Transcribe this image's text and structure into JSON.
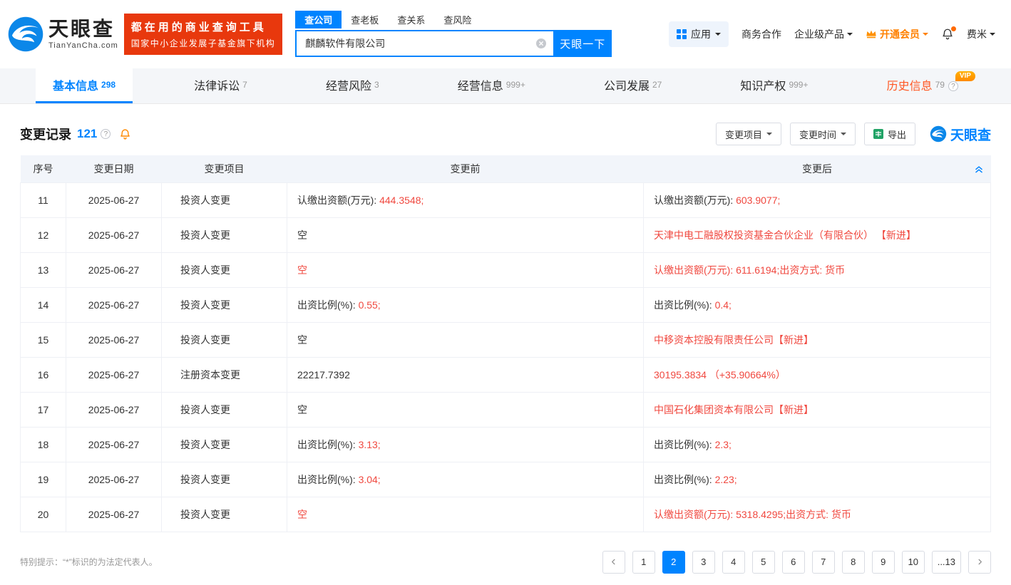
{
  "colors": {
    "primary": "#0084ff",
    "red": "#f0483f",
    "orange": "#ff8000",
    "vip_orange": "#ff9000",
    "slogan_red": "#e8380d",
    "excel_green": "#21a366",
    "history_tab": "#ff5722"
  },
  "brand": {
    "name": "天眼查",
    "domain": "TianYanCha.com",
    "slogan_line1": "都在用的商业查询工具",
    "slogan_line2": "国家中小企业发展子基金旗下机构"
  },
  "search": {
    "tabs": [
      {
        "label": "查公司",
        "active": true
      },
      {
        "label": "查老板",
        "active": false
      },
      {
        "label": "查关系",
        "active": false
      },
      {
        "label": "查风险",
        "active": false
      }
    ],
    "value": "麒麟软件有限公司",
    "button_label": "天眼一下"
  },
  "topnav": {
    "apps_label": "应用",
    "business_label": "商务合作",
    "enterprise_label": "企业级产品",
    "vip_label": "开通会员",
    "username": "费米"
  },
  "vip_badge": "VIP",
  "company_tabs": [
    {
      "label": "基本信息",
      "count": "298",
      "active": true
    },
    {
      "label": "法律诉讼",
      "count": "7"
    },
    {
      "label": "经营风险",
      "count": "3"
    },
    {
      "label": "经营信息",
      "count": "999+"
    },
    {
      "label": "公司发展",
      "count": "27"
    },
    {
      "label": "知识产权",
      "count": "999+"
    },
    {
      "label": "历史信息",
      "count": "79",
      "vip": true,
      "help": true
    }
  ],
  "section": {
    "title": "变更记录",
    "count": "121",
    "filter_project_label": "变更项目",
    "filter_time_label": "变更时间",
    "export_label": "导出",
    "watermark": "天眼查"
  },
  "table": {
    "headers": [
      "序号",
      "变更日期",
      "变更项目",
      "变更前",
      "变更后"
    ],
    "rows": [
      {
        "no": "11",
        "date": "2025-06-27",
        "item": "投资人变更",
        "before": [
          {
            "text": "认缴出资额(万元): ",
            "red": false
          },
          {
            "text": "444.3548;",
            "red": true
          }
        ],
        "after": [
          {
            "text": "认缴出资额(万元): ",
            "red": false
          },
          {
            "text": "603.9077;",
            "red": true
          }
        ]
      },
      {
        "no": "12",
        "date": "2025-06-27",
        "item": "投资人变更",
        "before": [
          {
            "text": "空",
            "red": false
          }
        ],
        "after": [
          {
            "text": "天津中电工融股权投资基金合伙企业（有限合伙） ",
            "red": true,
            "link": true
          },
          {
            "text": "【新进】",
            "red": true
          }
        ]
      },
      {
        "no": "13",
        "date": "2025-06-27",
        "item": "投资人变更",
        "before": [
          {
            "text": "空",
            "red": true
          }
        ],
        "after": [
          {
            "text": "认缴出资额(万元): 611.6194;出资方式: 货币",
            "red": true
          }
        ]
      },
      {
        "no": "14",
        "date": "2025-06-27",
        "item": "投资人变更",
        "before": [
          {
            "text": "出资比例(%): ",
            "red": false
          },
          {
            "text": "0.55;",
            "red": true
          }
        ],
        "after": [
          {
            "text": "出资比例(%): ",
            "red": false
          },
          {
            "text": "0.4;",
            "red": true
          }
        ]
      },
      {
        "no": "15",
        "date": "2025-06-27",
        "item": "投资人变更",
        "before": [
          {
            "text": "空",
            "red": false
          }
        ],
        "after": [
          {
            "text": "中移资本控股有限责任公司",
            "red": true,
            "link": true
          },
          {
            "text": "【新进】",
            "red": true
          }
        ]
      },
      {
        "no": "16",
        "date": "2025-06-27",
        "item": "注册资本变更",
        "before": [
          {
            "text": "22217.7392",
            "red": false
          }
        ],
        "after": [
          {
            "text": "30195.3834 （+35.90664%）",
            "red": true
          }
        ]
      },
      {
        "no": "17",
        "date": "2025-06-27",
        "item": "投资人变更",
        "before": [
          {
            "text": "空",
            "red": false
          }
        ],
        "after": [
          {
            "text": "中国石化集团资本有限公司",
            "red": true,
            "link": true
          },
          {
            "text": "【新进】",
            "red": true
          }
        ]
      },
      {
        "no": "18",
        "date": "2025-06-27",
        "item": "投资人变更",
        "before": [
          {
            "text": "出资比例(%): ",
            "red": false
          },
          {
            "text": "3.13;",
            "red": true
          }
        ],
        "after": [
          {
            "text": "出资比例(%): ",
            "red": false
          },
          {
            "text": "2.3;",
            "red": true
          }
        ]
      },
      {
        "no": "19",
        "date": "2025-06-27",
        "item": "投资人变更",
        "before": [
          {
            "text": "出资比例(%): ",
            "red": false
          },
          {
            "text": "3.04;",
            "red": true
          }
        ],
        "after": [
          {
            "text": "出资比例(%): ",
            "red": false
          },
          {
            "text": "2.23;",
            "red": true
          }
        ]
      },
      {
        "no": "20",
        "date": "2025-06-27",
        "item": "投资人变更",
        "before": [
          {
            "text": "空",
            "red": true
          }
        ],
        "after": [
          {
            "text": "认缴出资额(万元): 5318.4295;出资方式: 货币",
            "red": true
          }
        ]
      }
    ]
  },
  "footer_note": "特别提示：“*”标识的为法定代表人。",
  "pagination": {
    "pages": [
      "1",
      "2",
      "3",
      "4",
      "5",
      "6",
      "7",
      "8",
      "9",
      "10",
      "...13"
    ],
    "active": "2"
  }
}
